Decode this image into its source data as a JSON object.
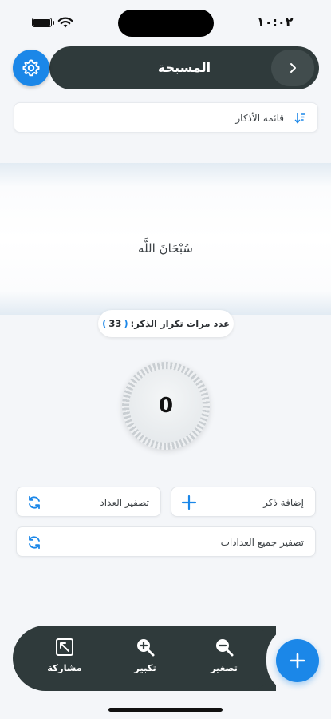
{
  "status_bar": {
    "time": "١٠:٠٢"
  },
  "header": {
    "title": "المسبحة"
  },
  "list": {
    "label": "قائمة الأذكار"
  },
  "dhikr": {
    "text": "سُبْحَانَ اللَّه"
  },
  "repeat": {
    "label": "عدد مرات تكرار الذكر:",
    "open": "(",
    "count": "33",
    "close": ")"
  },
  "counter": {
    "value": "0"
  },
  "actions": {
    "add_dhikr": "إضافة ذكر",
    "reset_counter": "تصفير العداد",
    "reset_all": "تصفير جميع العدادات"
  },
  "bottom_bar": {
    "zoom_out": "تصغير",
    "zoom_in": "تكبير",
    "share": "مشاركة"
  },
  "colors": {
    "accent": "#1b87e8",
    "dark": "#2f3a3b"
  },
  "icons": [
    "battery-icon",
    "wifi-icon",
    "chevron-right-icon",
    "gear-icon",
    "sort-icon",
    "plus-icon",
    "refresh-icon",
    "zoom-out-icon",
    "zoom-in-icon",
    "share-icon"
  ]
}
